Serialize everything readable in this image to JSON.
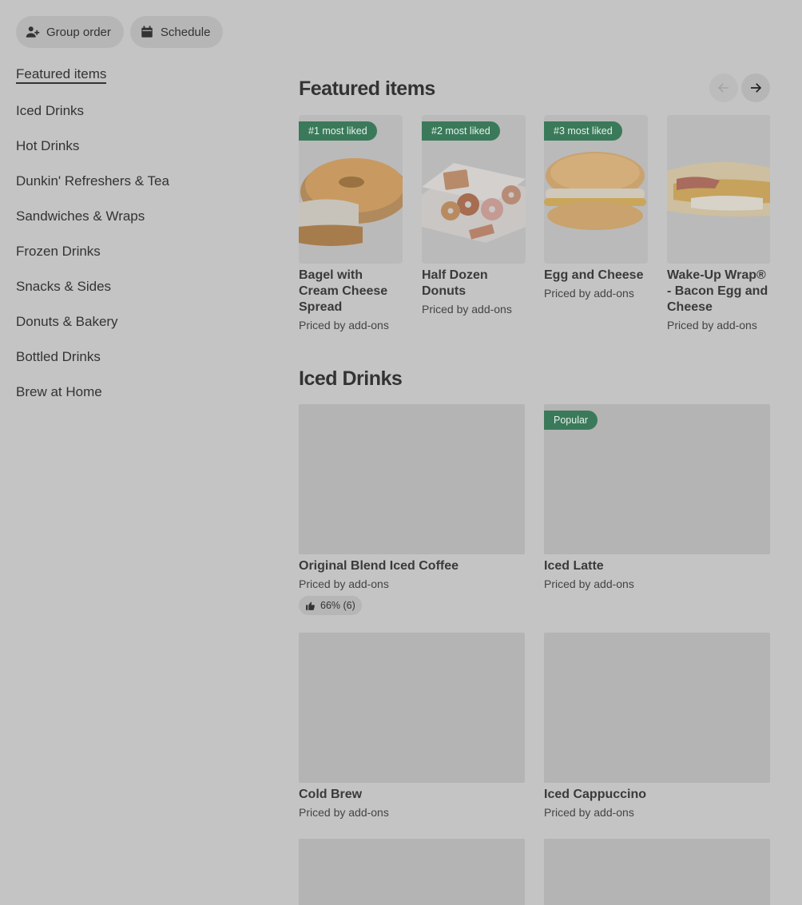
{
  "top_actions": {
    "group_order": "Group order",
    "schedule": "Schedule"
  },
  "sidebar": {
    "items": [
      {
        "label": "Featured items",
        "active": true
      },
      {
        "label": "Iced Drinks"
      },
      {
        "label": "Hot Drinks"
      },
      {
        "label": "Dunkin' Refreshers & Tea"
      },
      {
        "label": "Sandwiches & Wraps"
      },
      {
        "label": "Frozen Drinks"
      },
      {
        "label": "Snacks & Sides"
      },
      {
        "label": "Donuts & Bakery"
      },
      {
        "label": "Bottled Drinks"
      },
      {
        "label": "Brew at Home"
      }
    ]
  },
  "featured": {
    "title": "Featured items",
    "items": [
      {
        "badge": "#1 most liked",
        "name": "Bagel with Cream Cheese Spread",
        "price": "Priced by add-ons",
        "icon": "bagel-image"
      },
      {
        "badge": "#2 most liked",
        "name": "Half Dozen Donuts",
        "price": "Priced by add-ons",
        "icon": "donut-box-image"
      },
      {
        "badge": "#3 most liked",
        "name": "Egg and Cheese",
        "price": "Priced by add-ons",
        "icon": "egg-sandwich-image"
      },
      {
        "name": "Wake-Up Wrap® - Bacon Egg and Cheese",
        "price": "Priced by add-ons",
        "icon": "wrap-image"
      }
    ]
  },
  "iced": {
    "title": "Iced Drinks",
    "items": [
      {
        "name": "Original Blend Iced Coffee",
        "price": "Priced by add-ons",
        "rating": "66% (6)"
      },
      {
        "badge": "Popular",
        "name": "Iced Latte",
        "price": "Priced by add-ons"
      },
      {
        "name": "Cold Brew",
        "price": "Priced by add-ons"
      },
      {
        "name": "Iced Cappuccino",
        "price": "Priced by add-ons"
      }
    ]
  },
  "colors": {
    "overlay_bg": "#c4c4c4",
    "badge_green": "#3a7a5a",
    "placeholder": "#b4b4b4"
  }
}
